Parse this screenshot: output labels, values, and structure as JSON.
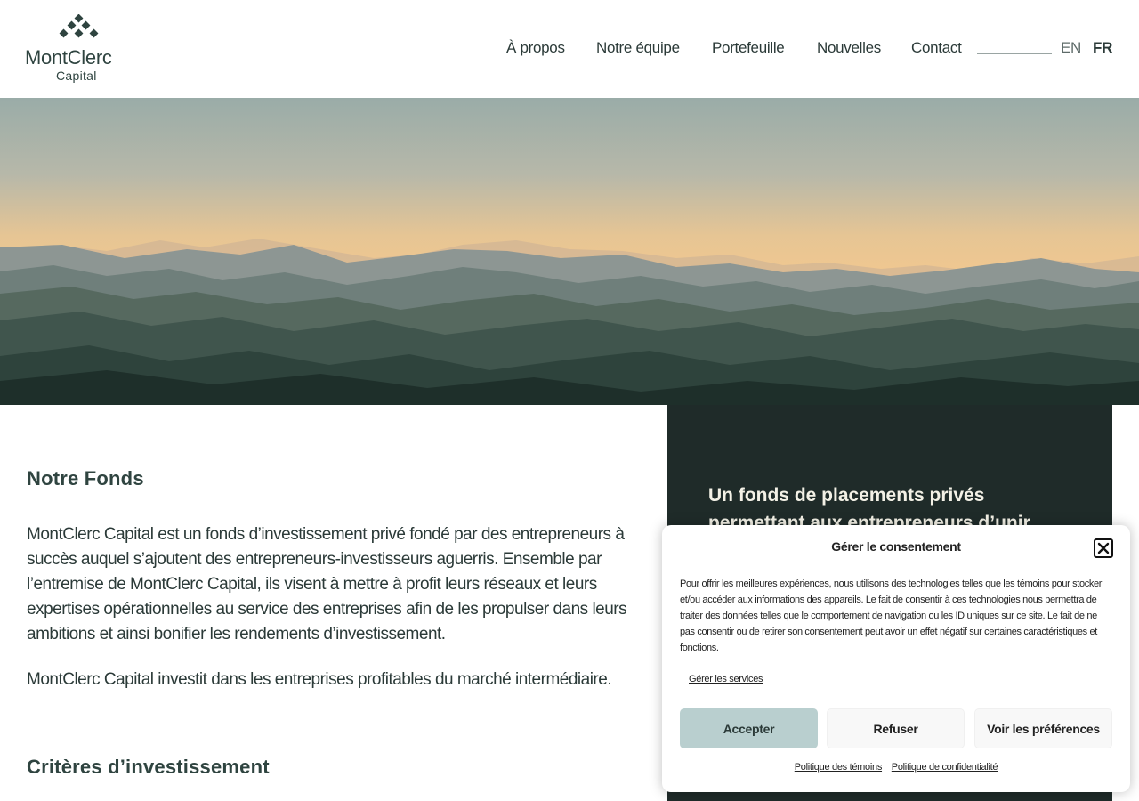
{
  "brand": {
    "name": "MontClerc",
    "sub": "Capital"
  },
  "nav": {
    "items": [
      {
        "label": "À propos"
      },
      {
        "label": "Notre équipe"
      },
      {
        "label": "Portefeuille"
      },
      {
        "label": "Nouvelles"
      },
      {
        "label": "Contact"
      }
    ],
    "lang_en": "EN",
    "lang_fr": "FR"
  },
  "main": {
    "heading": "Notre Fonds",
    "paragraph1": "MontClerc Capital est un fonds d’investissement privé fondé par des entrepreneurs à succès auquel s’ajoutent des entrepreneurs-investisseurs aguerris. Ensemble par l’entremise de MontClerc Capital, ils visent à mettre à profit leurs réseaux et leurs expertises opérationnelles au service des entreprises afin de les propulser dans leurs ambitions et ainsi bonifier les rendements d’investissement.",
    "paragraph2": "MontClerc Capital investit dans les entreprises profitables du marché intermédiaire.",
    "heading2": "Critères d’investissement"
  },
  "side": {
    "text": "Un fonds de placements privés permettant aux entrepreneurs d’unir"
  },
  "consent": {
    "title": "Gérer le consentement",
    "body": "Pour offrir les meilleures expériences, nous utilisons des technologies telles que les témoins pour stocker et/ou accéder aux informations des appareils. Le fait de consentir à ces technologies nous permettra de traiter des données telles que le comportement de navigation ou les ID uniques sur ce site. Le fait de ne pas consentir ou de retirer son consentement peut avoir un effet négatif sur certaines caractéristiques et fonctions.",
    "manage_services": "Gérer les services",
    "accept": "Accepter",
    "refuse": "Refuser",
    "preferences": "Voir les préférences",
    "cookie_policy": "Politique des témoins",
    "privacy_policy": "Politique de confidentialité"
  },
  "colors": {
    "dark_green": "#1f2b29",
    "accent": "#b9cfcf",
    "text": "#2b3a38"
  }
}
